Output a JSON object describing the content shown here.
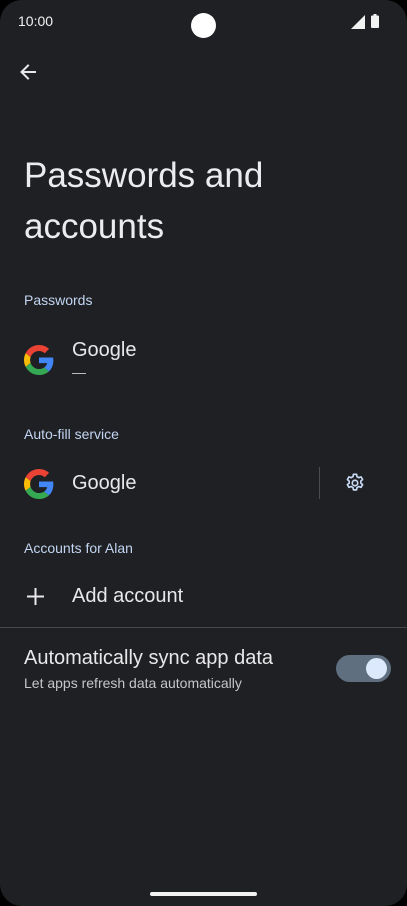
{
  "status_bar": {
    "time": "10:00"
  },
  "header": {
    "back_icon": "arrow-back-icon",
    "title": "Passwords and accounts"
  },
  "sections": {
    "passwords": {
      "header": "Passwords",
      "item": {
        "icon": "google-logo-icon",
        "title": "Google",
        "subtitle": "—"
      }
    },
    "autofill": {
      "header": "Auto-fill service",
      "item": {
        "icon": "google-logo-icon",
        "title": "Google",
        "settings_icon": "gear-icon"
      }
    },
    "accounts": {
      "header": "Accounts for Alan",
      "add_account": {
        "icon": "plus-icon",
        "label": "Add account"
      }
    },
    "sync": {
      "title": "Automatically sync app data",
      "subtitle": "Let apps refresh data automatically",
      "enabled": true
    }
  },
  "colors": {
    "background": "#1f2023",
    "accent_text": "#c2d5f2",
    "toggle_track": "#5f6f80",
    "toggle_thumb": "#dce8fb"
  }
}
